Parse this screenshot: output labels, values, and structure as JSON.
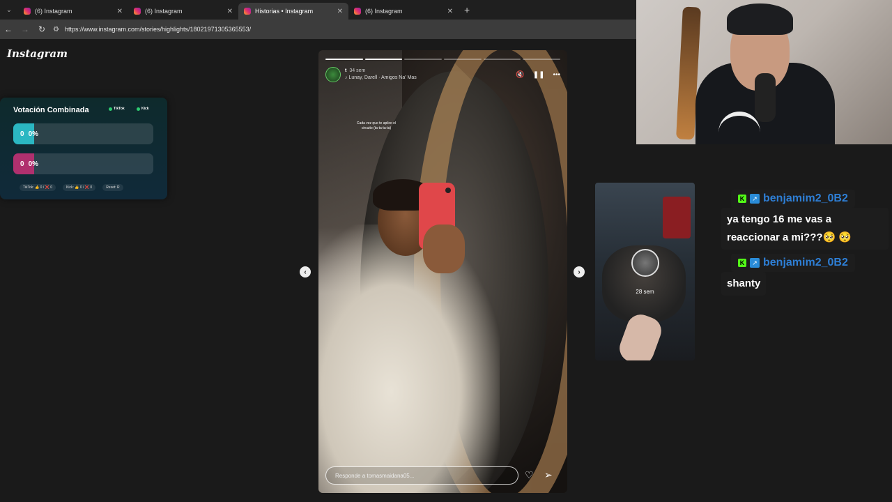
{
  "browser": {
    "tabs": [
      {
        "title": "(6) Instagram",
        "active": false
      },
      {
        "title": "(6) Instagram",
        "active": false
      },
      {
        "title": "Historias • Instagram",
        "active": true
      },
      {
        "title": "(6) Instagram",
        "active": false
      }
    ],
    "url": "https://www.instagram.com/stories/highlights/18021971305365553/",
    "new_tab": "+",
    "close": "✕"
  },
  "instagram": {
    "logo": "Instagram"
  },
  "poll": {
    "title": "Votación Combinada",
    "badges": [
      "TikTok",
      "Kick"
    ],
    "options": [
      {
        "count": "0",
        "percent": "0%",
        "color": "#2bb7c2"
      },
      {
        "count": "0",
        "percent": "0%",
        "color": "#b0306e"
      }
    ],
    "footer": {
      "tiktok": "TikTok: 👍 0 / ❌ 0",
      "kick": "Kick: 👍 0 / ❌ 0",
      "reset": "Reset: R"
    }
  },
  "story": {
    "username": "t",
    "time": "34 sem",
    "song": "Lunay, Darell · Amigos Na' Mas",
    "caption": "Cada vez que te aplico el circuito (ta-ta-ta-ta)",
    "reply_placeholder": "Responde a tomasmaidana05...",
    "progress": {
      "segments": 6,
      "done": 2
    }
  },
  "preview": {
    "time": "28 sem"
  },
  "chat": [
    {
      "user": "benjamim2_0B2",
      "message": "ya tengo 16 me vas a reaccionar a mi???🥺 🥺"
    },
    {
      "user": "benjamim2_0B2",
      "message": "shanty"
    }
  ],
  "colors": {
    "kick_green": "#53fc18",
    "chat_name": "#2e7fd6"
  },
  "icons": {
    "back": "arrow-left-icon",
    "forward": "arrow-right-icon",
    "reload": "reload-icon",
    "site_settings": "tune-icon",
    "mute": "muted-speaker-icon",
    "pause": "pause-icon",
    "more": "more-horizontal-icon",
    "like": "heart-icon",
    "share": "send-icon",
    "prev": "chevron-left-icon",
    "next": "chevron-right-icon"
  }
}
